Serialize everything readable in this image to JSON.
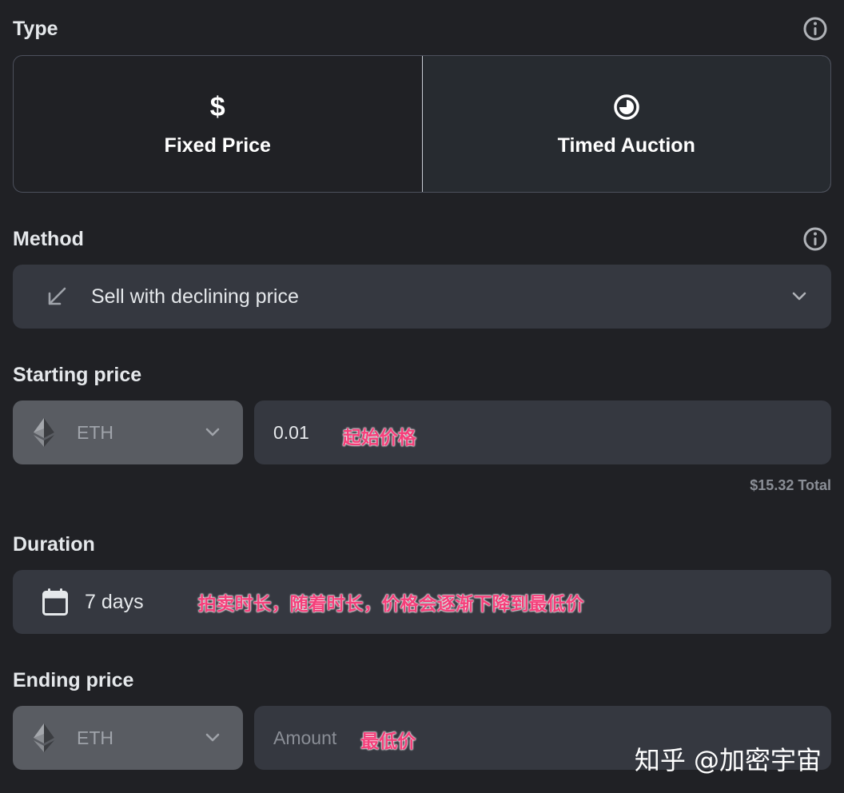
{
  "type_section": {
    "label": "Type",
    "options": [
      {
        "label": "Fixed Price",
        "icon": "dollar-icon",
        "glyph": "$",
        "selected": false
      },
      {
        "label": "Timed Auction",
        "icon": "clock-icon",
        "selected": true
      }
    ]
  },
  "method_section": {
    "label": "Method",
    "selected": "Sell with declining price",
    "icon": "arrow-down-left-icon"
  },
  "starting_price": {
    "label": "Starting price",
    "currency": "ETH",
    "value": "0.01",
    "annotation": "起始价格",
    "total": "$15.32 Total"
  },
  "duration": {
    "label": "Duration",
    "value": "7 days",
    "annotation": "拍卖时长，随着时长，价格会逐渐下降到最低价"
  },
  "ending_price": {
    "label": "Ending price",
    "currency": "ETH",
    "placeholder": "Amount",
    "annotation": "最低价"
  },
  "watermark": "知乎 @加密宇宙",
  "colors": {
    "background": "#202125",
    "field": "#353840",
    "currency_field": "#595c62",
    "annotation": "#f43f7a"
  }
}
